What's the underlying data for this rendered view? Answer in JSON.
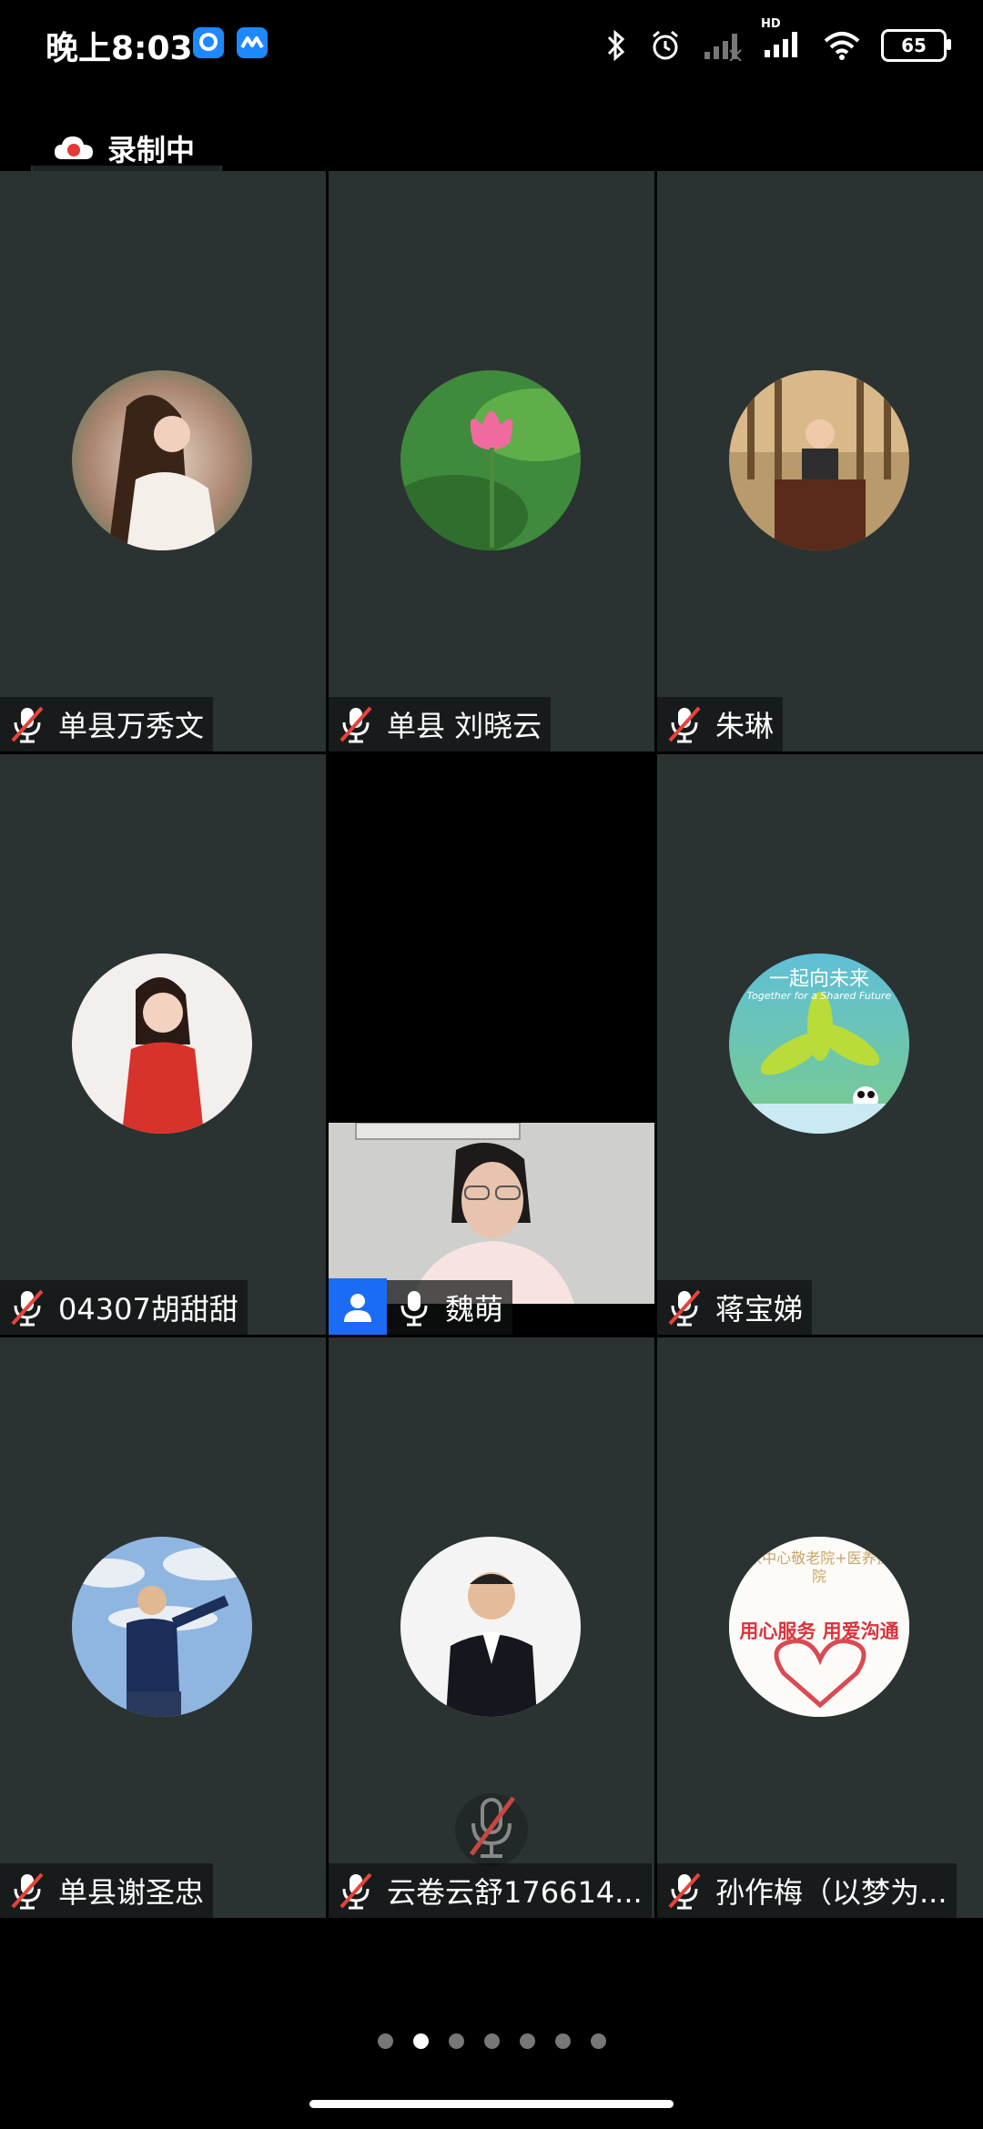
{
  "status_bar": {
    "time": "晚上8:03",
    "battery": "65",
    "hd_label": "HD"
  },
  "recording": {
    "label": "录制中"
  },
  "participants": [
    {
      "name": "单县万秀文",
      "muted": true,
      "avatar": "woman-white-dress-avatar"
    },
    {
      "name": "单县 刘晓云",
      "muted": true,
      "avatar": "lotus-flower-avatar"
    },
    {
      "name": "朱琳",
      "muted": true,
      "avatar": "child-at-podium-avatar"
    },
    {
      "name": "04307胡甜甜",
      "muted": true,
      "avatar": "woman-red-dress-avatar"
    },
    {
      "name": "魏萌",
      "muted": false,
      "video": true,
      "is_self": true
    },
    {
      "name": "蒋宝娣",
      "muted": true,
      "avatar": "together-shared-future-avatar",
      "avatar_text_cn": "一起向未来",
      "avatar_text_en": "Together for a Shared Future"
    },
    {
      "name": "单县谢圣忠",
      "muted": true,
      "avatar": "man-sky-avatar"
    },
    {
      "name": "云卷云舒176614...",
      "muted": true,
      "avatar": "man-suit-avatar"
    },
    {
      "name": "孙作梅（以梦为...",
      "muted": true,
      "avatar": "care-home-logo-avatar",
      "avatar_text_top": "家中心敬老院+医养护院",
      "avatar_text_main": "用心服务 用爱沟通"
    }
  ],
  "pager": {
    "total": 7,
    "active_index": 1
  },
  "colors": {
    "tile_bg": "#2b3232",
    "mute_red": "#e5443a",
    "self_badge": "#1a6cf5"
  }
}
